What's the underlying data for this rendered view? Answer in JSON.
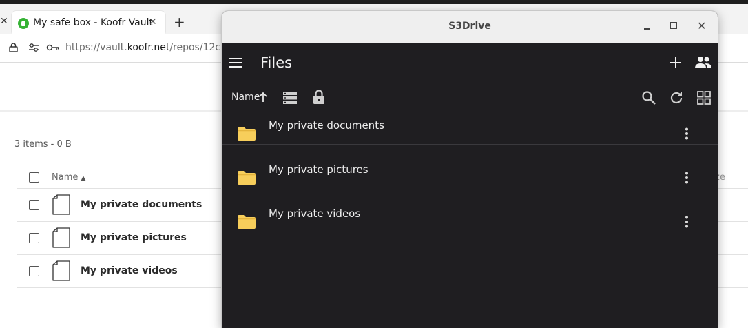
{
  "browser": {
    "tab_title": "My safe box - Koofr Vault",
    "tab_close": "✕",
    "tab_left_close": "✕",
    "new_tab": "+",
    "url_prefix": "https://vault.",
    "url_domain": "koofr.net",
    "url_suffix": "/repos/12c"
  },
  "vault_page": {
    "items_count": "3 items - 0 B",
    "col_name": "Name",
    "col_size_fragment": "ze",
    "files": [
      {
        "name": "My private documents"
      },
      {
        "name": "My private pictures"
      },
      {
        "name": "My private videos"
      }
    ]
  },
  "s3drive": {
    "window_title": "S3Drive",
    "close_glyph": "✕",
    "page_title": "Files",
    "sort_label": "Name",
    "folders": [
      {
        "name": "My private documents"
      },
      {
        "name": "My private pictures"
      },
      {
        "name": "My private videos"
      }
    ],
    "icons": {
      "folder_color": "#f7ce5b",
      "accent_dark": "#1f1e21"
    }
  }
}
